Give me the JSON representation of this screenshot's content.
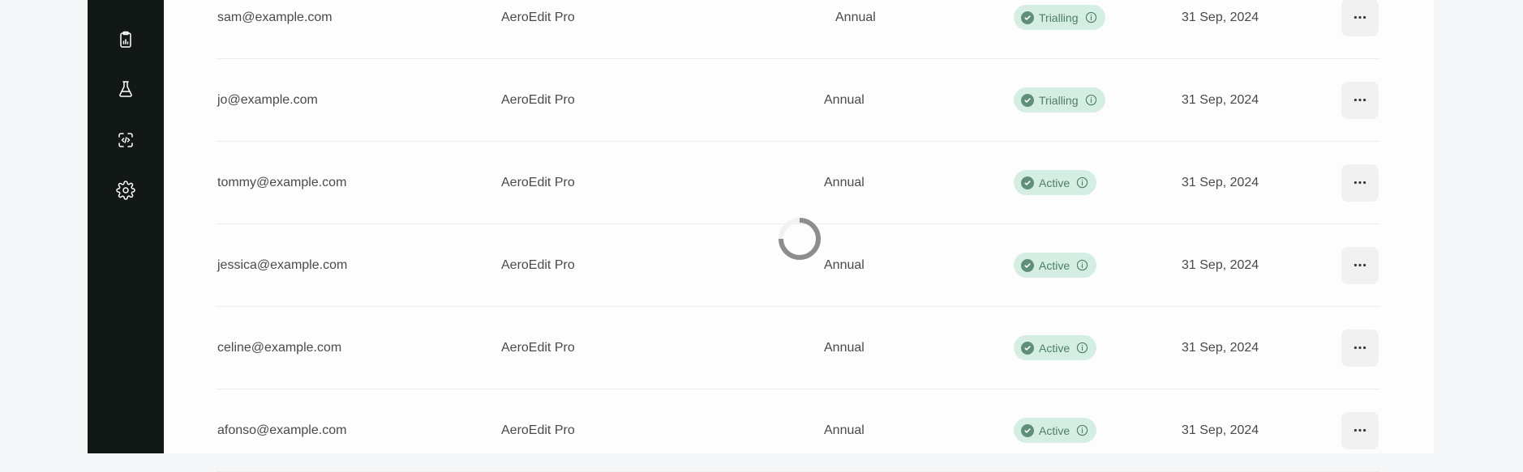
{
  "sidebar": {
    "items": [
      {
        "icon": "clipboard-icon"
      },
      {
        "icon": "flask-icon"
      },
      {
        "icon": "code-icon"
      },
      {
        "icon": "gear-icon"
      }
    ]
  },
  "table": {
    "rows": [
      {
        "email": "sam@example.com",
        "product": "AeroEdit Pro",
        "billing": "Annual",
        "status": "Trialling",
        "date": "31 Sep, 2024"
      },
      {
        "email": "jo@example.com",
        "product": "AeroEdit Pro",
        "billing": "Annual",
        "status": "Trialling",
        "date": "31 Sep, 2024"
      },
      {
        "email": "tommy@example.com",
        "product": "AeroEdit Pro",
        "billing": "Annual",
        "status": "Active",
        "date": "31 Sep, 2024"
      },
      {
        "email": "jessica@example.com",
        "product": "AeroEdit Pro",
        "billing": "Annual",
        "status": "Active",
        "date": "31 Sep, 2024"
      },
      {
        "email": "celine@example.com",
        "product": "AeroEdit Pro",
        "billing": "Annual",
        "status": "Active",
        "date": "31 Sep, 2024"
      },
      {
        "email": "afonso@example.com",
        "product": "AeroEdit Pro",
        "billing": "Annual",
        "status": "Active",
        "date": "31 Sep, 2024"
      }
    ]
  },
  "colors": {
    "sidebar_bg": "#111816",
    "badge_bg": "#d5eee3",
    "badge_text": "#4f7d6a"
  },
  "loading": {
    "icon": "loading-spinner-icon"
  }
}
